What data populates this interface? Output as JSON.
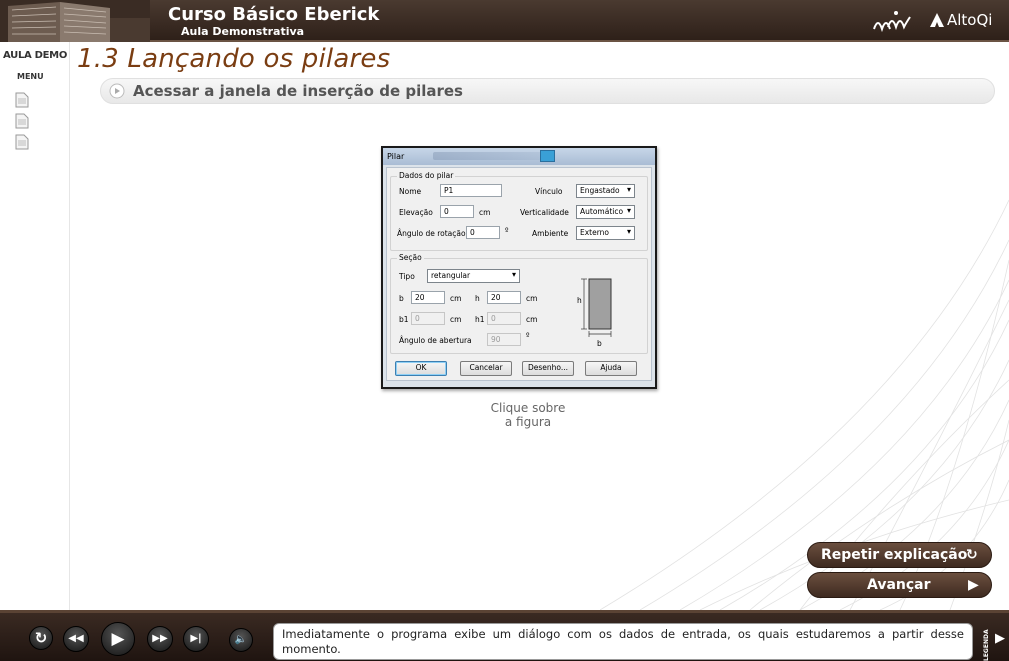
{
  "header": {
    "course_title": "Curso Básico Eberick",
    "course_subtitle": "Aula Demonstrativa",
    "brand_name": "AltoQi"
  },
  "sidebar": {
    "aula_demo": "AULA DEMO",
    "menu": "MENU"
  },
  "lesson": {
    "title": "1.3 Lançando os pilares",
    "step": "Acessar a janela de inserção de pilares"
  },
  "dialog": {
    "title": "Pilar",
    "group_dados": "Dados do pilar",
    "nome_label": "Nome",
    "nome_value": "P1",
    "elevacao_label": "Elevação",
    "elevacao_value": "0",
    "elevacao_unit": "cm",
    "angulo_rotacao_label": "Ângulo de rotação",
    "angulo_rotacao_value": "0",
    "angulo_unit": "º",
    "vinculo_label": "Vínculo",
    "vinculo_value": "Engastado",
    "verticalidade_label": "Verticalidade",
    "verticalidade_value": "Automático",
    "ambiente_label": "Ambiente",
    "ambiente_value": "Externo",
    "group_secao": "Seção",
    "tipo_label": "Tipo",
    "tipo_value": "retangular",
    "b_label": "b",
    "b_value": "20",
    "h_label": "h",
    "h_value": "20",
    "b1_label": "b1",
    "b1_value": "0",
    "h1_label": "h1",
    "h1_value": "0",
    "cm": "cm",
    "angulo_abertura_label": "Ângulo de abertura",
    "angulo_abertura_value": "90",
    "diagram_h": "h",
    "diagram_b": "b",
    "ok": "OK",
    "cancelar": "Cancelar",
    "desenho": "Desenho...",
    "ajuda": "Ajuda"
  },
  "caption": {
    "line1": "Clique sobre",
    "line2": "a figura"
  },
  "actions": {
    "repetir": "Repetir explicação",
    "avancar": "Avançar"
  },
  "footer": {
    "message": "Imediatamente o programa exibe um diálogo com os dados de entrada, os quais estudaremos a partir desse momento.",
    "legenda": "LEGENDA"
  },
  "colors": {
    "brand_dark": "#3e2a20",
    "title_brown": "#7a3d12",
    "header_bg": "#2e2019"
  }
}
